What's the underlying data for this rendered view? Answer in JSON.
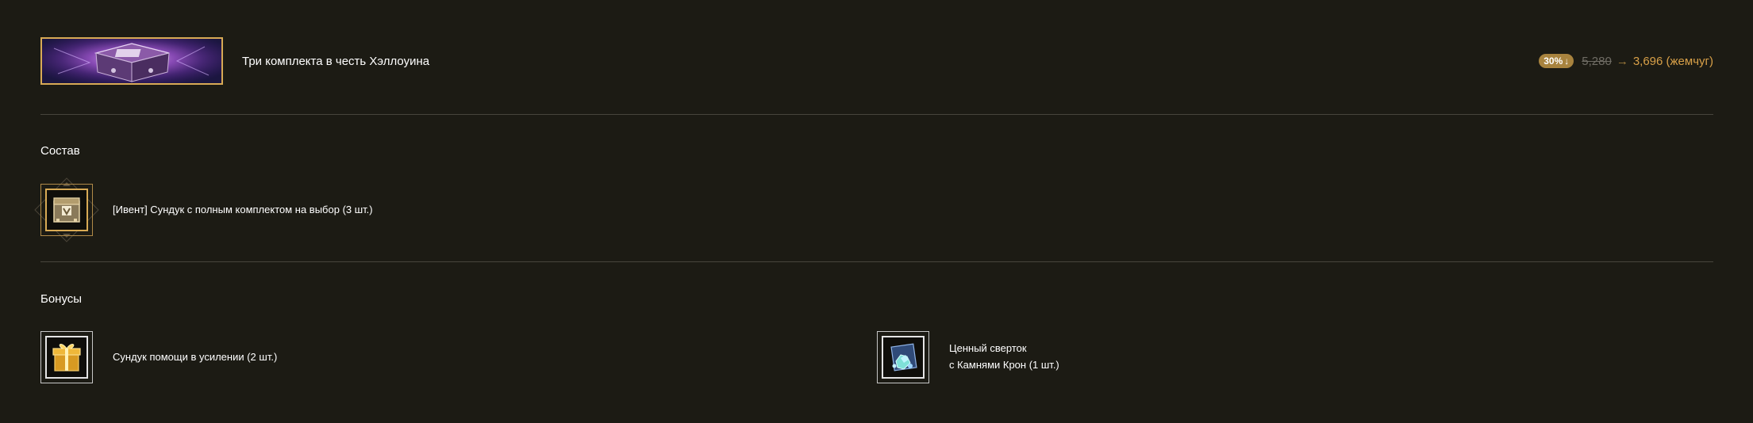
{
  "product": {
    "title": "Три комплекта в честь Хэллоуина",
    "discount": "30%",
    "discount_icon": "down-arrow-icon",
    "old_price": "5,280",
    "arrow": "→",
    "new_price": "3,696 (жемчуг)"
  },
  "composition": {
    "heading": "Состав",
    "items": [
      {
        "label": "[Ивент] Сундук с полным комплектом на выбор (3 шт.)",
        "icon": "chest-icon"
      }
    ]
  },
  "bonuses": {
    "heading": "Бонусы",
    "items": [
      {
        "label": "Сундук помощи в усилении (2 шт.)",
        "icon": "gift-box-icon"
      },
      {
        "label_line1": "Ценный сверток",
        "label_line2": "с Камнями Крон (1 шт.)",
        "icon": "gem-pouch-icon"
      }
    ]
  },
  "colors": {
    "background": "#1c1b14",
    "accent_gold": "#d8aa55",
    "price_gold": "#d8a048",
    "divider": "#47453c"
  }
}
